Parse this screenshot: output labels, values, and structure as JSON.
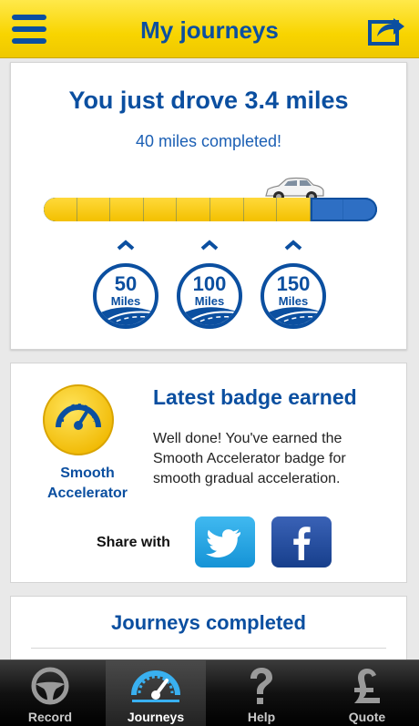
{
  "header": {
    "title": "My journeys"
  },
  "summary": {
    "headline": "You just drove 3.4 miles",
    "subline": "40 miles completed!",
    "progress": {
      "value": 40,
      "max": 50
    },
    "milestones": [
      {
        "number": "50",
        "unit": "Miles"
      },
      {
        "number": "100",
        "unit": "Miles"
      },
      {
        "number": "150",
        "unit": "Miles"
      }
    ]
  },
  "badge": {
    "name_line1": "Smooth",
    "name_line2": "Accelerator",
    "title": "Latest badge earned",
    "description": "Well done! You've earned the Smooth Accelerator badge for smooth gradual acceleration.",
    "share_label": "Share with"
  },
  "journeys": {
    "title": "Journeys completed"
  },
  "tabs": [
    {
      "label": "Record",
      "icon": "steering-wheel-icon"
    },
    {
      "label": "Journeys",
      "icon": "speedometer-icon",
      "active": true
    },
    {
      "label": "Help",
      "icon": "question-icon"
    },
    {
      "label": "Quote",
      "icon": "pound-icon"
    }
  ],
  "colors": {
    "brand_blue": "#0b4fa0",
    "header_yellow": "#f8d400"
  }
}
